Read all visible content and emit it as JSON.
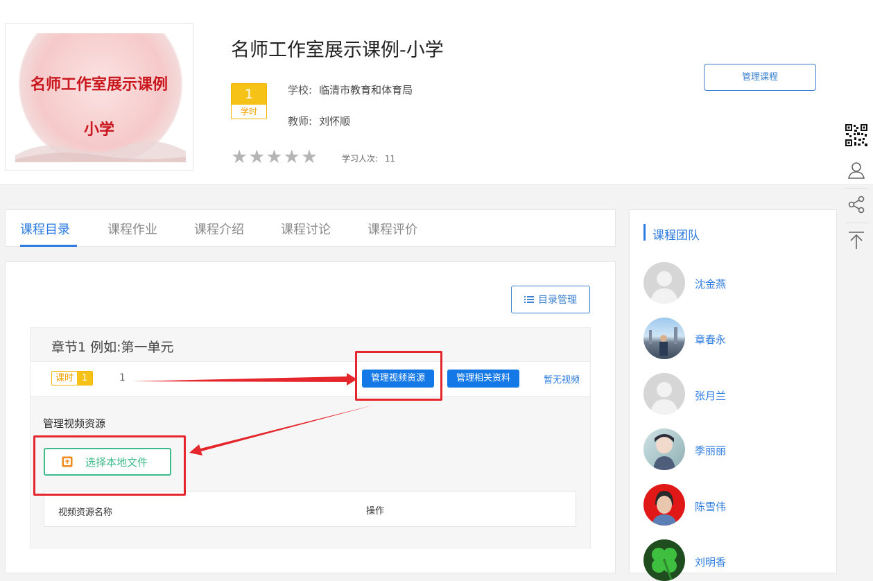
{
  "course": {
    "cover_line1": "名师工作室展示课例",
    "cover_line2": "小学",
    "title": "名师工作室展示课例-小学",
    "hours_value": "1",
    "hours_label": "学时",
    "school_label": "学校:",
    "school": "临清市教育和体育局",
    "teacher_label": "教师:",
    "teacher": "刘怀顺",
    "stars": "★★★★★",
    "learners_label": "学习人次:",
    "learners": "11",
    "rating": 0,
    "manage_button": "管理课程"
  },
  "side_tools": [
    "qr-code-icon",
    "user-icon",
    "share-icon",
    "back-to-top-icon"
  ],
  "tabs": [
    {
      "label": "课程目录",
      "active": true
    },
    {
      "label": "课程作业",
      "active": false
    },
    {
      "label": "课程介绍",
      "active": false
    },
    {
      "label": "课程讨论",
      "active": false
    },
    {
      "label": "课程评价",
      "active": false
    }
  ],
  "catalog": {
    "manage_button": "目录管理",
    "chapter_title": "章节1 例如:第一单元",
    "lesson": {
      "tag_label": "课时",
      "tag_num": "1",
      "number": "1",
      "manage_video_button": "管理视频资源",
      "manage_material_button": "管理相关资料",
      "no_video": "暂无视频"
    },
    "video_section": {
      "title": "管理视频资源",
      "choose_file_button": "选择本地文件",
      "table_headers": [
        "视频资源名称",
        "操作"
      ]
    }
  },
  "team": {
    "title": "课程团队",
    "members": [
      {
        "name": "沈金燕",
        "avatar": "default-avatar"
      },
      {
        "name": "章春永",
        "avatar": "photo-avatar"
      },
      {
        "name": "张月兰",
        "avatar": "default-avatar"
      },
      {
        "name": "季丽丽",
        "avatar": "photo-avatar"
      },
      {
        "name": "陈雪伟",
        "avatar": "photo-avatar"
      },
      {
        "name": "刘明香",
        "avatar": "clover-avatar"
      }
    ]
  },
  "colors": {
    "accent": "#2c7be0",
    "primary_button": "#1479e6",
    "badge": "#f7c218",
    "annotation": "#e5262c",
    "upload_button": "#3dbb8b"
  }
}
